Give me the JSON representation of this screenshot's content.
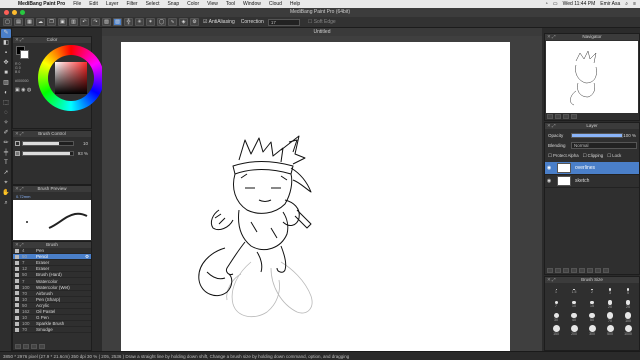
{
  "menubar": {
    "apple": "",
    "app": "MediBang Paint Pro",
    "items": [
      "File",
      "Edit",
      "Layer",
      "Filter",
      "Select",
      "Snap",
      "Color",
      "View",
      "Tool",
      "Window",
      "Cloud",
      "Help"
    ],
    "clock": "Wed 11:44 PM",
    "user": "Emir Asa"
  },
  "window": {
    "title": "MediBang Paint Pro (64bit)",
    "document_title": "Untitled"
  },
  "toolbar": {
    "antialiasing": "AntiAliasing",
    "correction_label": "Correction",
    "correction_value": "17",
    "soft_edge": "Soft Edge"
  },
  "color_panel": {
    "title": "Color",
    "hex": "#000000",
    "main_color": "#000000",
    "sub_color": "#ffffff"
  },
  "brush_control": {
    "title": "Brush Control",
    "size": "10",
    "size_fraction": 0.72,
    "opacity": "93 %",
    "opacity_fraction": 0.93
  },
  "brush_preview": {
    "title": "Brush Preview",
    "size_label": "0.72mm"
  },
  "brush_panel": {
    "title": "Brush",
    "items": [
      {
        "size": "4",
        "name": "Pen"
      },
      {
        "size": "50",
        "name": "Pencil",
        "selected": true
      },
      {
        "size": "7",
        "name": "Eraser"
      },
      {
        "size": "12",
        "name": "Eraser"
      },
      {
        "size": "50",
        "name": "Brush (Hard)"
      },
      {
        "size": "7",
        "name": "Watercolor"
      },
      {
        "size": "100",
        "name": "Watercolor (Wet)"
      },
      {
        "size": "70",
        "name": "Airbrush"
      },
      {
        "size": "10",
        "name": "Pen (Sharp)"
      },
      {
        "size": "50",
        "name": "Acrylic"
      },
      {
        "size": "162",
        "name": "Oil Pastel"
      },
      {
        "size": "10",
        "name": "G Pen"
      },
      {
        "size": "100",
        "name": "Sparkle Brush"
      },
      {
        "size": "70",
        "name": "Smudge"
      }
    ]
  },
  "navigator": {
    "title": "Navigator"
  },
  "layer_panel": {
    "title": "Layer",
    "opacity_label": "Opacity",
    "opacity_value": "100 %",
    "blending_label": "Blending",
    "blending_value": "Normal",
    "protect_alpha": "Protect Alpha",
    "clipping": "Clipping",
    "lock": "Lock",
    "layers": [
      {
        "name": "overlines",
        "selected": true
      },
      {
        "name": "sketch",
        "selected": false
      }
    ]
  },
  "brush_size_panel": {
    "title": "Brush Size",
    "sizes": [
      "1",
      "1.5",
      "2",
      "3",
      "5",
      "7",
      "10",
      "15",
      "20",
      "25",
      "30",
      "40",
      "50",
      "70",
      "100",
      "150",
      "200",
      "300",
      "500",
      "1000"
    ]
  },
  "status": {
    "text": "3850 * 2976 pixel   (27.9 * 21.6cm)   350 dpi   30 %   ( 205, 2536 )   Draw a straight line by holding down shift, Change a brush size by holding down command, option, and dragging"
  },
  "colors": {
    "accent": "#4a7fc9",
    "panel": "#2f2f2f",
    "canvas_bg": "#3f3f3f"
  }
}
